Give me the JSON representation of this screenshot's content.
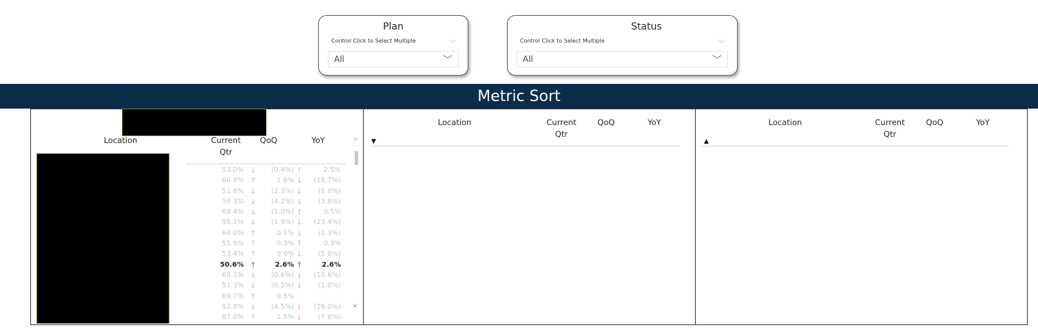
{
  "slicers": {
    "plan": {
      "title": "Plan",
      "hint": "Control Click to Select Multiple",
      "value": "All"
    },
    "status": {
      "title": "Status",
      "hint": "Control Click to Select Multiple",
      "value": "All"
    }
  },
  "banner": {
    "title": "Metric Sort"
  },
  "panels": [
    {
      "headers": {
        "location": "Location",
        "current": "Current Qtr",
        "qoq": "QoQ",
        "yoy": "YoY"
      },
      "rows": [
        {
          "cur": "53.0%",
          "qoq_dir": "down",
          "qoq": "(0.4%)",
          "yoy_dir": "up",
          "yoy": "2.5%"
        },
        {
          "cur": "60.9%",
          "qoq_dir": "up",
          "qoq": "1.6%",
          "yoy_dir": "down",
          "yoy": "(18.7%)"
        },
        {
          "cur": "51.6%",
          "qoq_dir": "down",
          "qoq": "(2.3%)",
          "yoy_dir": "down",
          "yoy": "(5.0%)"
        },
        {
          "cur": "54.3%",
          "qoq_dir": "down",
          "qoq": "(4.2%)",
          "yoy_dir": "down",
          "yoy": "(3.8%)"
        },
        {
          "cur": "69.4%",
          "qoq_dir": "down",
          "qoq": "(1.0%)",
          "yoy_dir": "up",
          "yoy": "0.5%"
        },
        {
          "cur": "55.1%",
          "qoq_dir": "down",
          "qoq": "(1.9%)",
          "yoy_dir": "down",
          "yoy": "(23.4%)"
        },
        {
          "cur": "64.0%",
          "qoq_dir": "up",
          "qoq": "0.1%",
          "yoy_dir": "down",
          "yoy": "(1.3%)"
        },
        {
          "cur": "55.9%",
          "qoq_dir": "up",
          "qoq": "0.3%",
          "yoy_dir": "up",
          "yoy": "0.3%"
        },
        {
          "cur": "53.4%",
          "qoq_dir": "up",
          "qoq": "0.0%",
          "yoy_dir": "down",
          "yoy": "(5.8%)"
        },
        {
          "cur": "50.6%",
          "qoq_dir": "up",
          "qoq": "2.6%",
          "yoy_dir": "up",
          "yoy": "2.6%",
          "highlight": true
        },
        {
          "cur": "68.3%",
          "qoq_dir": "down",
          "qoq": "(0.6%)",
          "yoy_dir": "down",
          "yoy": "(10.6%)"
        },
        {
          "cur": "51.3%",
          "qoq_dir": "down",
          "qoq": "(6.5%)",
          "yoy_dir": "down",
          "yoy": "(1.8%)"
        },
        {
          "cur": "69.7%",
          "qoq_dir": "up",
          "qoq": "0.5%",
          "yoy_dir": "",
          "yoy": ""
        },
        {
          "cur": "52.8%",
          "qoq_dir": "down",
          "qoq": "(4.5%)",
          "yoy_dir": "down",
          "yoy": "(29.0%)"
        },
        {
          "cur": "67.0%",
          "qoq_dir": "up",
          "qoq": "1.5%",
          "yoy_dir": "down",
          "yoy": "(7.8%)"
        }
      ]
    },
    {
      "headers": {
        "location": "Location",
        "current": "Current Qtr",
        "qoq": "QoQ",
        "yoy": "YoY"
      },
      "sort": "descending"
    },
    {
      "headers": {
        "location": "Location",
        "current": "Current Qtr",
        "qoq": "QoQ",
        "yoy": "YoY"
      },
      "sort": "ascending"
    }
  ],
  "icons": {
    "up": "arrow-up-icon",
    "down": "arrow-down-icon",
    "chevron": "chevron-down-icon"
  },
  "colors": {
    "banner": "#0b2d4b",
    "up_muted": "#a9d8a9",
    "down_muted": "#f3b4a8",
    "up_strong": "#3a9a3a"
  }
}
